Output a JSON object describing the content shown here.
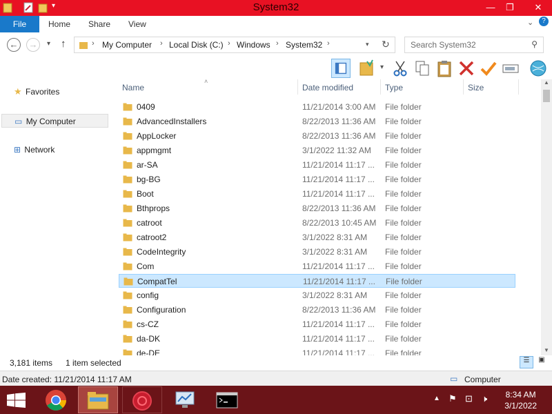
{
  "window": {
    "title": "System32"
  },
  "ribbon": {
    "tabs": [
      "File",
      "Home",
      "Share",
      "View"
    ]
  },
  "address": {
    "crumbs": [
      "My Computer",
      "Local Disk (C:)",
      "Windows",
      "System32"
    ]
  },
  "search": {
    "placeholder": "Search System32"
  },
  "navpane": {
    "items": [
      "Favorites",
      "My Computer",
      "Network"
    ]
  },
  "columns": {
    "name": "Name",
    "date": "Date modified",
    "type": "Type",
    "size": "Size"
  },
  "files": [
    {
      "name": "0409",
      "date": "11/21/2014 3:00 AM",
      "type": "File folder"
    },
    {
      "name": "AdvancedInstallers",
      "date": "8/22/2013 11:36 AM",
      "type": "File folder"
    },
    {
      "name": "AppLocker",
      "date": "8/22/2013 11:36 AM",
      "type": "File folder"
    },
    {
      "name": "appmgmt",
      "date": "3/1/2022 11:32 AM",
      "type": "File folder"
    },
    {
      "name": "ar-SA",
      "date": "11/21/2014 11:17 ...",
      "type": "File folder"
    },
    {
      "name": "bg-BG",
      "date": "11/21/2014 11:17 ...",
      "type": "File folder"
    },
    {
      "name": "Boot",
      "date": "11/21/2014 11:17 ...",
      "type": "File folder"
    },
    {
      "name": "Bthprops",
      "date": "8/22/2013 11:36 AM",
      "type": "File folder"
    },
    {
      "name": "catroot",
      "date": "8/22/2013 10:45 AM",
      "type": "File folder"
    },
    {
      "name": "catroot2",
      "date": "3/1/2022 8:31 AM",
      "type": "File folder"
    },
    {
      "name": "CodeIntegrity",
      "date": "3/1/2022 8:31 AM",
      "type": "File folder"
    },
    {
      "name": "Com",
      "date": "11/21/2014 11:17 ...",
      "type": "File folder"
    },
    {
      "name": "CompatTel",
      "date": "11/21/2014 11:17 ...",
      "type": "File folder",
      "selected": true
    },
    {
      "name": "config",
      "date": "3/1/2022 8:31 AM",
      "type": "File folder"
    },
    {
      "name": "Configuration",
      "date": "8/22/2013 11:36 AM",
      "type": "File folder"
    },
    {
      "name": "cs-CZ",
      "date": "11/21/2014 11:17 ...",
      "type": "File folder"
    },
    {
      "name": "da-DK",
      "date": "11/21/2014 11:17 ...",
      "type": "File folder"
    },
    {
      "name": "de-DE",
      "date": "11/21/2014 11:17 ...",
      "type": "File folder"
    }
  ],
  "status": {
    "count": "3,181 items",
    "selected": "1 item selected"
  },
  "details": {
    "date_created": "Date created: 11/21/2014 11:17 AM",
    "location": "Computer"
  },
  "clock": {
    "time": "8:34 AM",
    "date": "3/1/2022"
  },
  "colors": {
    "titlebar": "#e81123",
    "taskbar": "#6b1418",
    "accent": "#1979ca",
    "selection": "#cce8ff",
    "folder": "#e8b84a"
  }
}
